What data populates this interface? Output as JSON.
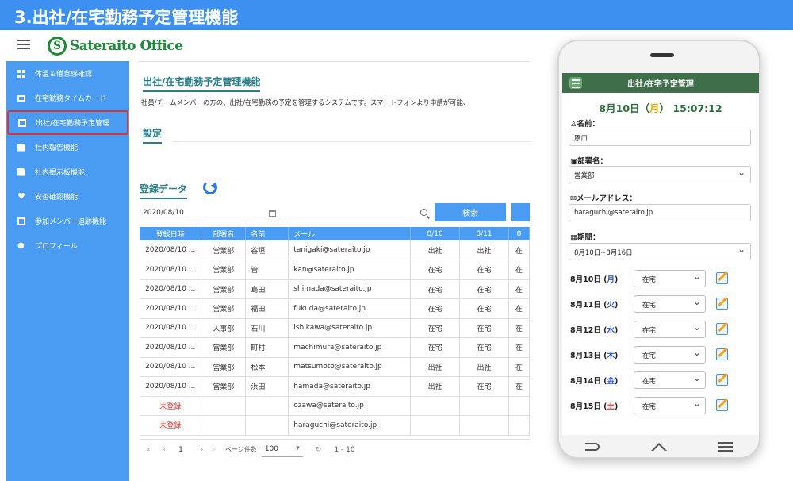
{
  "banner": {
    "title": "3.出社/在宅勤務予定管理機能"
  },
  "logo": {
    "mark": "S",
    "text": "Sateraito Office"
  },
  "sidebar": {
    "items": [
      {
        "label": "体温＆倦怠感確認"
      },
      {
        "label": "在宅勤務タイムカード"
      },
      {
        "label": "出社/在宅勤務予定管理"
      },
      {
        "label": "社内報告機能"
      },
      {
        "label": "社内掲示板機能"
      },
      {
        "label": "安否確認機能"
      },
      {
        "label": "参加メンバー追跡機能"
      },
      {
        "label": "プロフィール"
      }
    ]
  },
  "main": {
    "title": "出社/在宅勤務予定管理機能",
    "description": "社員/チームメンバーの方の、出社/在宅勤務の予定を管理するシステムです。スマートフォンより申請が可能、",
    "settings_title": "設定",
    "registration_title": "登録データ",
    "date_value": "2020/08/10",
    "search_button": "検索",
    "table": {
      "headers": [
        "登録日時",
        "部署名",
        "名前",
        "メール",
        "8/10",
        "8/11",
        "8"
      ],
      "rows": [
        [
          "2020/08/10 ...",
          "営業部",
          "谷垣",
          "tanigaki@sateraito.jp",
          "出社",
          "出社",
          "在"
        ],
        [
          "2020/08/10 ...",
          "営業部",
          "管",
          "kan@sateraito.jp",
          "在宅",
          "在宅",
          "在"
        ],
        [
          "2020/08/10 ...",
          "営業部",
          "島田",
          "shimada@sateraito.jp",
          "在宅",
          "在宅",
          "在"
        ],
        [
          "2020/08/10 ...",
          "営業部",
          "福田",
          "fukuda@sateraito.jp",
          "在宅",
          "在宅",
          "在"
        ],
        [
          "2020/08/10 ...",
          "人事部",
          "石川",
          "ishikawa@sateraito.jp",
          "在宅",
          "在宅",
          "在"
        ],
        [
          "2020/08/10 ...",
          "営業部",
          "町村",
          "machimura@sateraito.jp",
          "在宅",
          "在宅",
          "在"
        ],
        [
          "2020/08/10 ...",
          "営業部",
          "松本",
          "matsumoto@sateraito.jp",
          "出社",
          "出社",
          "在"
        ],
        [
          "2020/08/10 ...",
          "営業部",
          "浜田",
          "hamada@sateraito.jp",
          "出社",
          "在宅",
          "在"
        ],
        [
          "未登録",
          "",
          "",
          "ozawa@sateraito.jp",
          "",
          "",
          ""
        ],
        [
          "未登録",
          "",
          "",
          "haraguchi@sateraito.jp",
          "",
          "",
          ""
        ]
      ]
    },
    "pager": {
      "first": "«",
      "prev": "‹",
      "page": "1",
      "next": "›",
      "last": "»",
      "size_label": "ページ件数",
      "size": "100",
      "refresh": "↻",
      "range": "1 - 10"
    }
  },
  "phone": {
    "header": "出社/在宅予定管理",
    "time": {
      "date": "8月10日（",
      "weekday": "月",
      "rest": "）  15:07:12"
    },
    "name_label": "名前：",
    "name_value": "原口",
    "dept_label": "部署名：",
    "dept_value": "営業部",
    "email_label": "メールアドレス：",
    "email_value": "haraguchi@sateraito.jp",
    "period_label": "期間：",
    "period_value": "8月10日~8月16日",
    "days": [
      {
        "date": "8月10日 (",
        "wd": "月",
        "close": ")",
        "value": "在宅"
      },
      {
        "date": "8月11日 (",
        "wd": "火",
        "close": ")",
        "value": "在宅"
      },
      {
        "date": "8月12日 (",
        "wd": "水",
        "close": ")",
        "value": "在宅"
      },
      {
        "date": "8月13日 (",
        "wd": "木",
        "close": ")",
        "value": "在宅"
      },
      {
        "date": "8月14日 (",
        "wd": "金",
        "close": ")",
        "value": "在宅"
      },
      {
        "date": "8月15日 (",
        "wd": "土",
        "close": ")",
        "value": "在宅"
      }
    ]
  }
}
